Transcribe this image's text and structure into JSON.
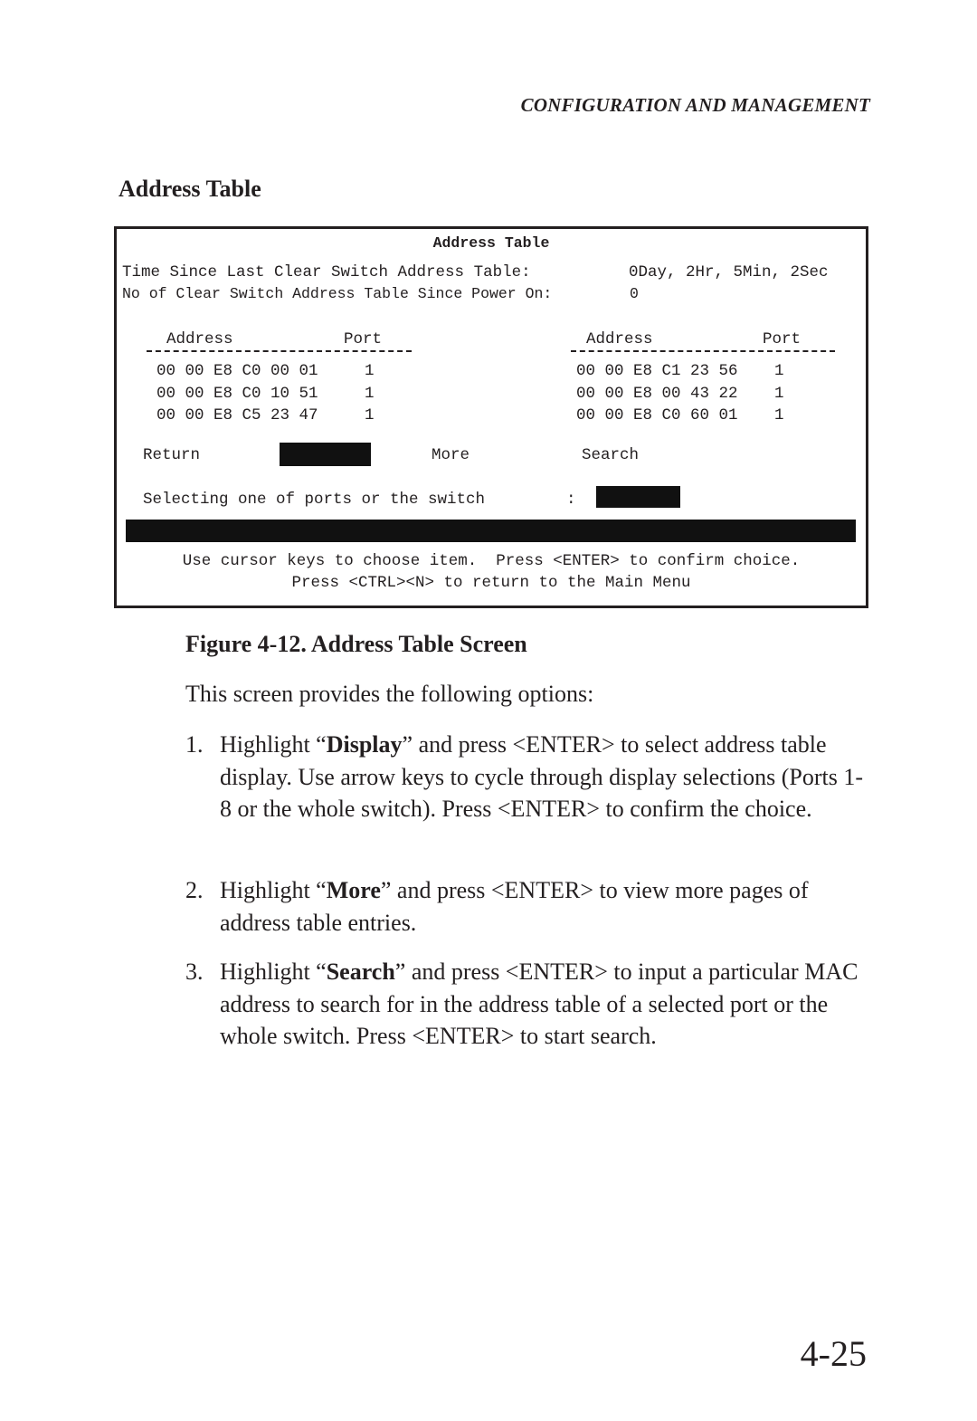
{
  "running_head": "CONFIGURATION AND MANAGEMENT",
  "section_title": "Address Table",
  "screen": {
    "title": "Address Table",
    "time_since_clear_label": "Time Since Last Clear Switch Address Table:",
    "time_since_clear_value": "0Day, 2Hr, 5Min, 2Sec",
    "clear_count_label": "No of Clear Switch Address Table Since Power On:",
    "clear_count_value": "0",
    "columns": {
      "left": {
        "address_header": "Address",
        "port_header": "Port"
      },
      "right": {
        "address_header": "Address",
        "port_header": "Port"
      }
    },
    "left_rows": [
      {
        "address": "00 00 E8 C0 00 01",
        "port": "1"
      },
      {
        "address": "00 00 E8 C0 10 51",
        "port": "1"
      },
      {
        "address": "00 00 E8 C5 23 47",
        "port": "1"
      }
    ],
    "right_rows": [
      {
        "address": "00 00 E8 C1 23 56",
        "port": "1"
      },
      {
        "address": "00 00 E8 00 43 22",
        "port": "1"
      },
      {
        "address": "00 00 E8 C0 60 01",
        "port": "1"
      }
    ],
    "menu": {
      "return_label": "Return",
      "display_label": "",
      "more_label": "More",
      "search_label": "Search"
    },
    "select_prompt": "Selecting one of ports or the switch",
    "select_colon": ":",
    "select_value": "",
    "help_line_1": "Use cursor keys to choose item.  Press <ENTER> to confirm choice.",
    "help_line_2": "Press <CTRL><N> to return to the Main Menu"
  },
  "figure_caption": "Figure 4-12.  Address Table Screen",
  "intro": "This screen provides the following options:",
  "items": [
    {
      "num": "1.",
      "pre": "Highlight “",
      "bold": "Display",
      "post": "” and press <ENTER> to select address table display.  Use arrow keys to cycle through display selections (Ports 1-8 or the whole switch).  Press <ENTER> to confirm the choice."
    },
    {
      "num": "2.",
      "pre": "Highlight “",
      "bold": "More",
      "post": "” and press <ENTER> to view more pages of address table entries."
    },
    {
      "num": "3.",
      "pre": "Highlight “",
      "bold": "Search",
      "post": "” and press <ENTER> to input a particular MAC address to search for in the address table of a selected port or the whole switch.  Press <ENTER> to start search."
    }
  ],
  "page_number": "4-25"
}
